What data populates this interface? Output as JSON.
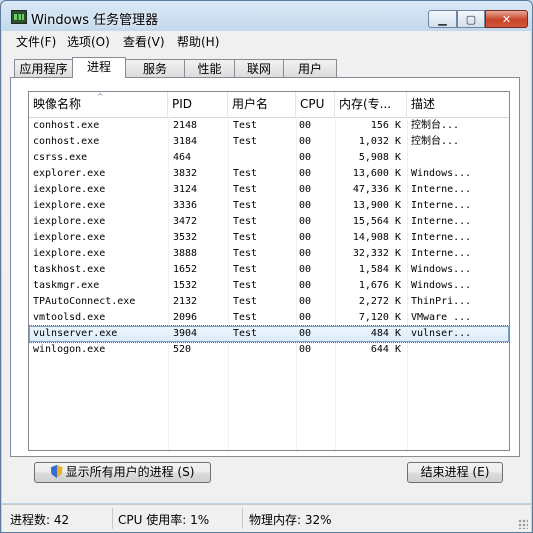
{
  "window": {
    "title": "Windows 任务管理器"
  },
  "menu": [
    "文件(F)",
    "选项(O)",
    "查看(V)",
    "帮助(H)"
  ],
  "tabs": [
    "应用程序",
    "进程",
    "服务",
    "性能",
    "联网",
    "用户"
  ],
  "active_tab": "进程",
  "columns": [
    "映像名称",
    "PID",
    "用户名",
    "CPU",
    "内存(专...",
    "描述"
  ],
  "processes": [
    {
      "name": "conhost.exe",
      "pid": "2148",
      "user": "Test",
      "cpu": "00",
      "mem": "156 K",
      "desc": "控制台..."
    },
    {
      "name": "conhost.exe",
      "pid": "3184",
      "user": "Test",
      "cpu": "00",
      "mem": "1,032 K",
      "desc": "控制台..."
    },
    {
      "name": "csrss.exe",
      "pid": "464",
      "user": "",
      "cpu": "00",
      "mem": "5,908 K",
      "desc": ""
    },
    {
      "name": "explorer.exe",
      "pid": "3832",
      "user": "Test",
      "cpu": "00",
      "mem": "13,600 K",
      "desc": "Windows..."
    },
    {
      "name": "iexplore.exe",
      "pid": "3124",
      "user": "Test",
      "cpu": "00",
      "mem": "47,336 K",
      "desc": "Interne..."
    },
    {
      "name": "iexplore.exe",
      "pid": "3336",
      "user": "Test",
      "cpu": "00",
      "mem": "13,900 K",
      "desc": "Interne..."
    },
    {
      "name": "iexplore.exe",
      "pid": "3472",
      "user": "Test",
      "cpu": "00",
      "mem": "15,564 K",
      "desc": "Interne..."
    },
    {
      "name": "iexplore.exe",
      "pid": "3532",
      "user": "Test",
      "cpu": "00",
      "mem": "14,908 K",
      "desc": "Interne..."
    },
    {
      "name": "iexplore.exe",
      "pid": "3888",
      "user": "Test",
      "cpu": "00",
      "mem": "32,332 K",
      "desc": "Interne..."
    },
    {
      "name": "taskhost.exe",
      "pid": "1652",
      "user": "Test",
      "cpu": "00",
      "mem": "1,584 K",
      "desc": "Windows..."
    },
    {
      "name": "taskmgr.exe",
      "pid": "1532",
      "user": "Test",
      "cpu": "00",
      "mem": "1,676 K",
      "desc": "Windows..."
    },
    {
      "name": "TPAutoConnect.exe",
      "pid": "2132",
      "user": "Test",
      "cpu": "00",
      "mem": "2,272 K",
      "desc": "ThinPri..."
    },
    {
      "name": "vmtoolsd.exe",
      "pid": "2096",
      "user": "Test",
      "cpu": "00",
      "mem": "7,120 K",
      "desc": "VMware ..."
    },
    {
      "name": "vulnserver.exe",
      "pid": "3904",
      "user": "Test",
      "cpu": "00",
      "mem": "484 K",
      "desc": "vulnser...",
      "selected": true
    },
    {
      "name": "winlogon.exe",
      "pid": "520",
      "user": "",
      "cpu": "00",
      "mem": "644 K",
      "desc": ""
    }
  ],
  "buttons": {
    "show_all": "显示所有用户的进程 (S)",
    "end_process": "结束进程 (E)"
  },
  "status": {
    "processes": "进程数: 42",
    "cpu": "CPU 使用率: 1%",
    "memory": "物理内存: 32%"
  }
}
